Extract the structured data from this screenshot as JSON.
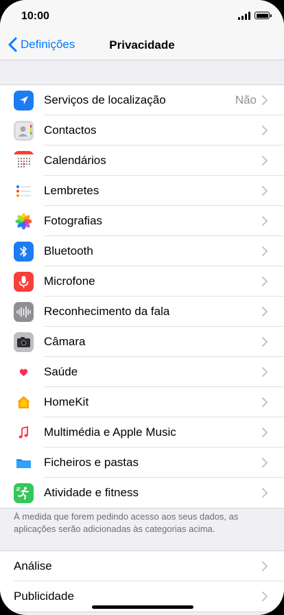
{
  "status_bar": {
    "time": "10:00"
  },
  "nav": {
    "back_label": "Definições",
    "title": "Privacidade"
  },
  "groups": [
    {
      "items": [
        {
          "name": "location-services",
          "label": "Serviços de localização",
          "value": "Não",
          "icon": "location-arrow-icon",
          "color": "#1c7cf2"
        },
        {
          "name": "contacts",
          "label": "Contactos",
          "icon": "contacts-icon",
          "color": "#c7c7cc"
        },
        {
          "name": "calendars",
          "label": "Calendários",
          "icon": "calendar-icon",
          "color": "#ff3b30"
        },
        {
          "name": "reminders",
          "label": "Lembretes",
          "icon": "reminders-icon",
          "color": "#ffffff"
        },
        {
          "name": "photos",
          "label": "Fotografias",
          "icon": "photos-icon",
          "color": "#ffffff"
        },
        {
          "name": "bluetooth",
          "label": "Bluetooth",
          "icon": "bluetooth-icon",
          "color": "#1c7cf2"
        },
        {
          "name": "microphone",
          "label": "Microfone",
          "icon": "microphone-icon",
          "color": "#ff3b30"
        },
        {
          "name": "speech-recognition",
          "label": "Reconhecimento da fala",
          "icon": "waveform-icon",
          "color": "#8e8e93"
        },
        {
          "name": "camera",
          "label": "Câmara",
          "icon": "camera-icon",
          "color": "#8e8e93"
        },
        {
          "name": "health",
          "label": "Saúde",
          "icon": "heart-icon",
          "color": "#ffffff"
        },
        {
          "name": "homekit",
          "label": "HomeKit",
          "icon": "home-icon",
          "color": "#ffffff"
        },
        {
          "name": "media-apple-music",
          "label": "Multimédia e Apple Music",
          "icon": "music-note-icon",
          "color": "#ffffff"
        },
        {
          "name": "files-folders",
          "label": "Ficheiros e pastas",
          "icon": "folder-icon",
          "color": "#ffffff"
        },
        {
          "name": "motion-fitness",
          "label": "Atividade e fitness",
          "icon": "running-figure-icon",
          "color": "#34c759"
        }
      ]
    },
    {
      "items": [
        {
          "name": "analytics",
          "label": "Análise"
        },
        {
          "name": "advertising",
          "label": "Publicidade"
        }
      ]
    }
  ],
  "footer_note": "À medida que forem pedindo acesso aos seus dados, as aplicações serão adicionadas às categorias acima.",
  "colors": {
    "accent": "#007aff",
    "background": "#efeff4"
  }
}
